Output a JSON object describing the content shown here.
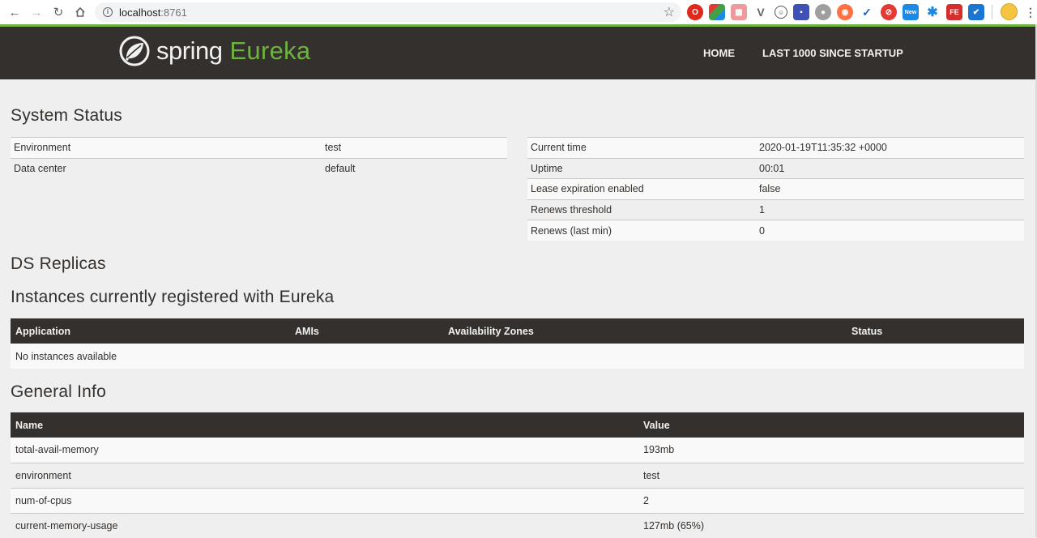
{
  "browser": {
    "url_host": "localhost",
    "url_port": ":8761"
  },
  "navbar": {
    "brand_spring": "spring",
    "brand_eureka": "Eureka",
    "links": [
      "HOME",
      "LAST 1000 SINCE STARTUP"
    ]
  },
  "system_status": {
    "title": "System Status",
    "left": [
      {
        "key": "Environment",
        "value": "test"
      },
      {
        "key": "Data center",
        "value": "default"
      }
    ],
    "right": [
      {
        "key": "Current time",
        "value": "2020-01-19T11:35:32 +0000"
      },
      {
        "key": "Uptime",
        "value": "00:01"
      },
      {
        "key": "Lease expiration enabled",
        "value": "false"
      },
      {
        "key": "Renews threshold",
        "value": "1"
      },
      {
        "key": "Renews (last min)",
        "value": "0"
      }
    ]
  },
  "ds_replicas": {
    "title": "DS Replicas"
  },
  "instances": {
    "title": "Instances currently registered with Eureka",
    "columns": [
      "Application",
      "AMIs",
      "Availability Zones",
      "Status"
    ],
    "empty_message": "No instances available"
  },
  "general_info": {
    "title": "General Info",
    "columns": [
      "Name",
      "Value"
    ],
    "rows": [
      {
        "name": "total-avail-memory",
        "value": "193mb"
      },
      {
        "name": "environment",
        "value": "test"
      },
      {
        "name": "num-of-cpus",
        "value": "2"
      },
      {
        "name": "current-memory-usage",
        "value": "127mb (65%)"
      }
    ]
  },
  "colors": {
    "spring_green": "#6db33f",
    "dark": "#34302d"
  }
}
